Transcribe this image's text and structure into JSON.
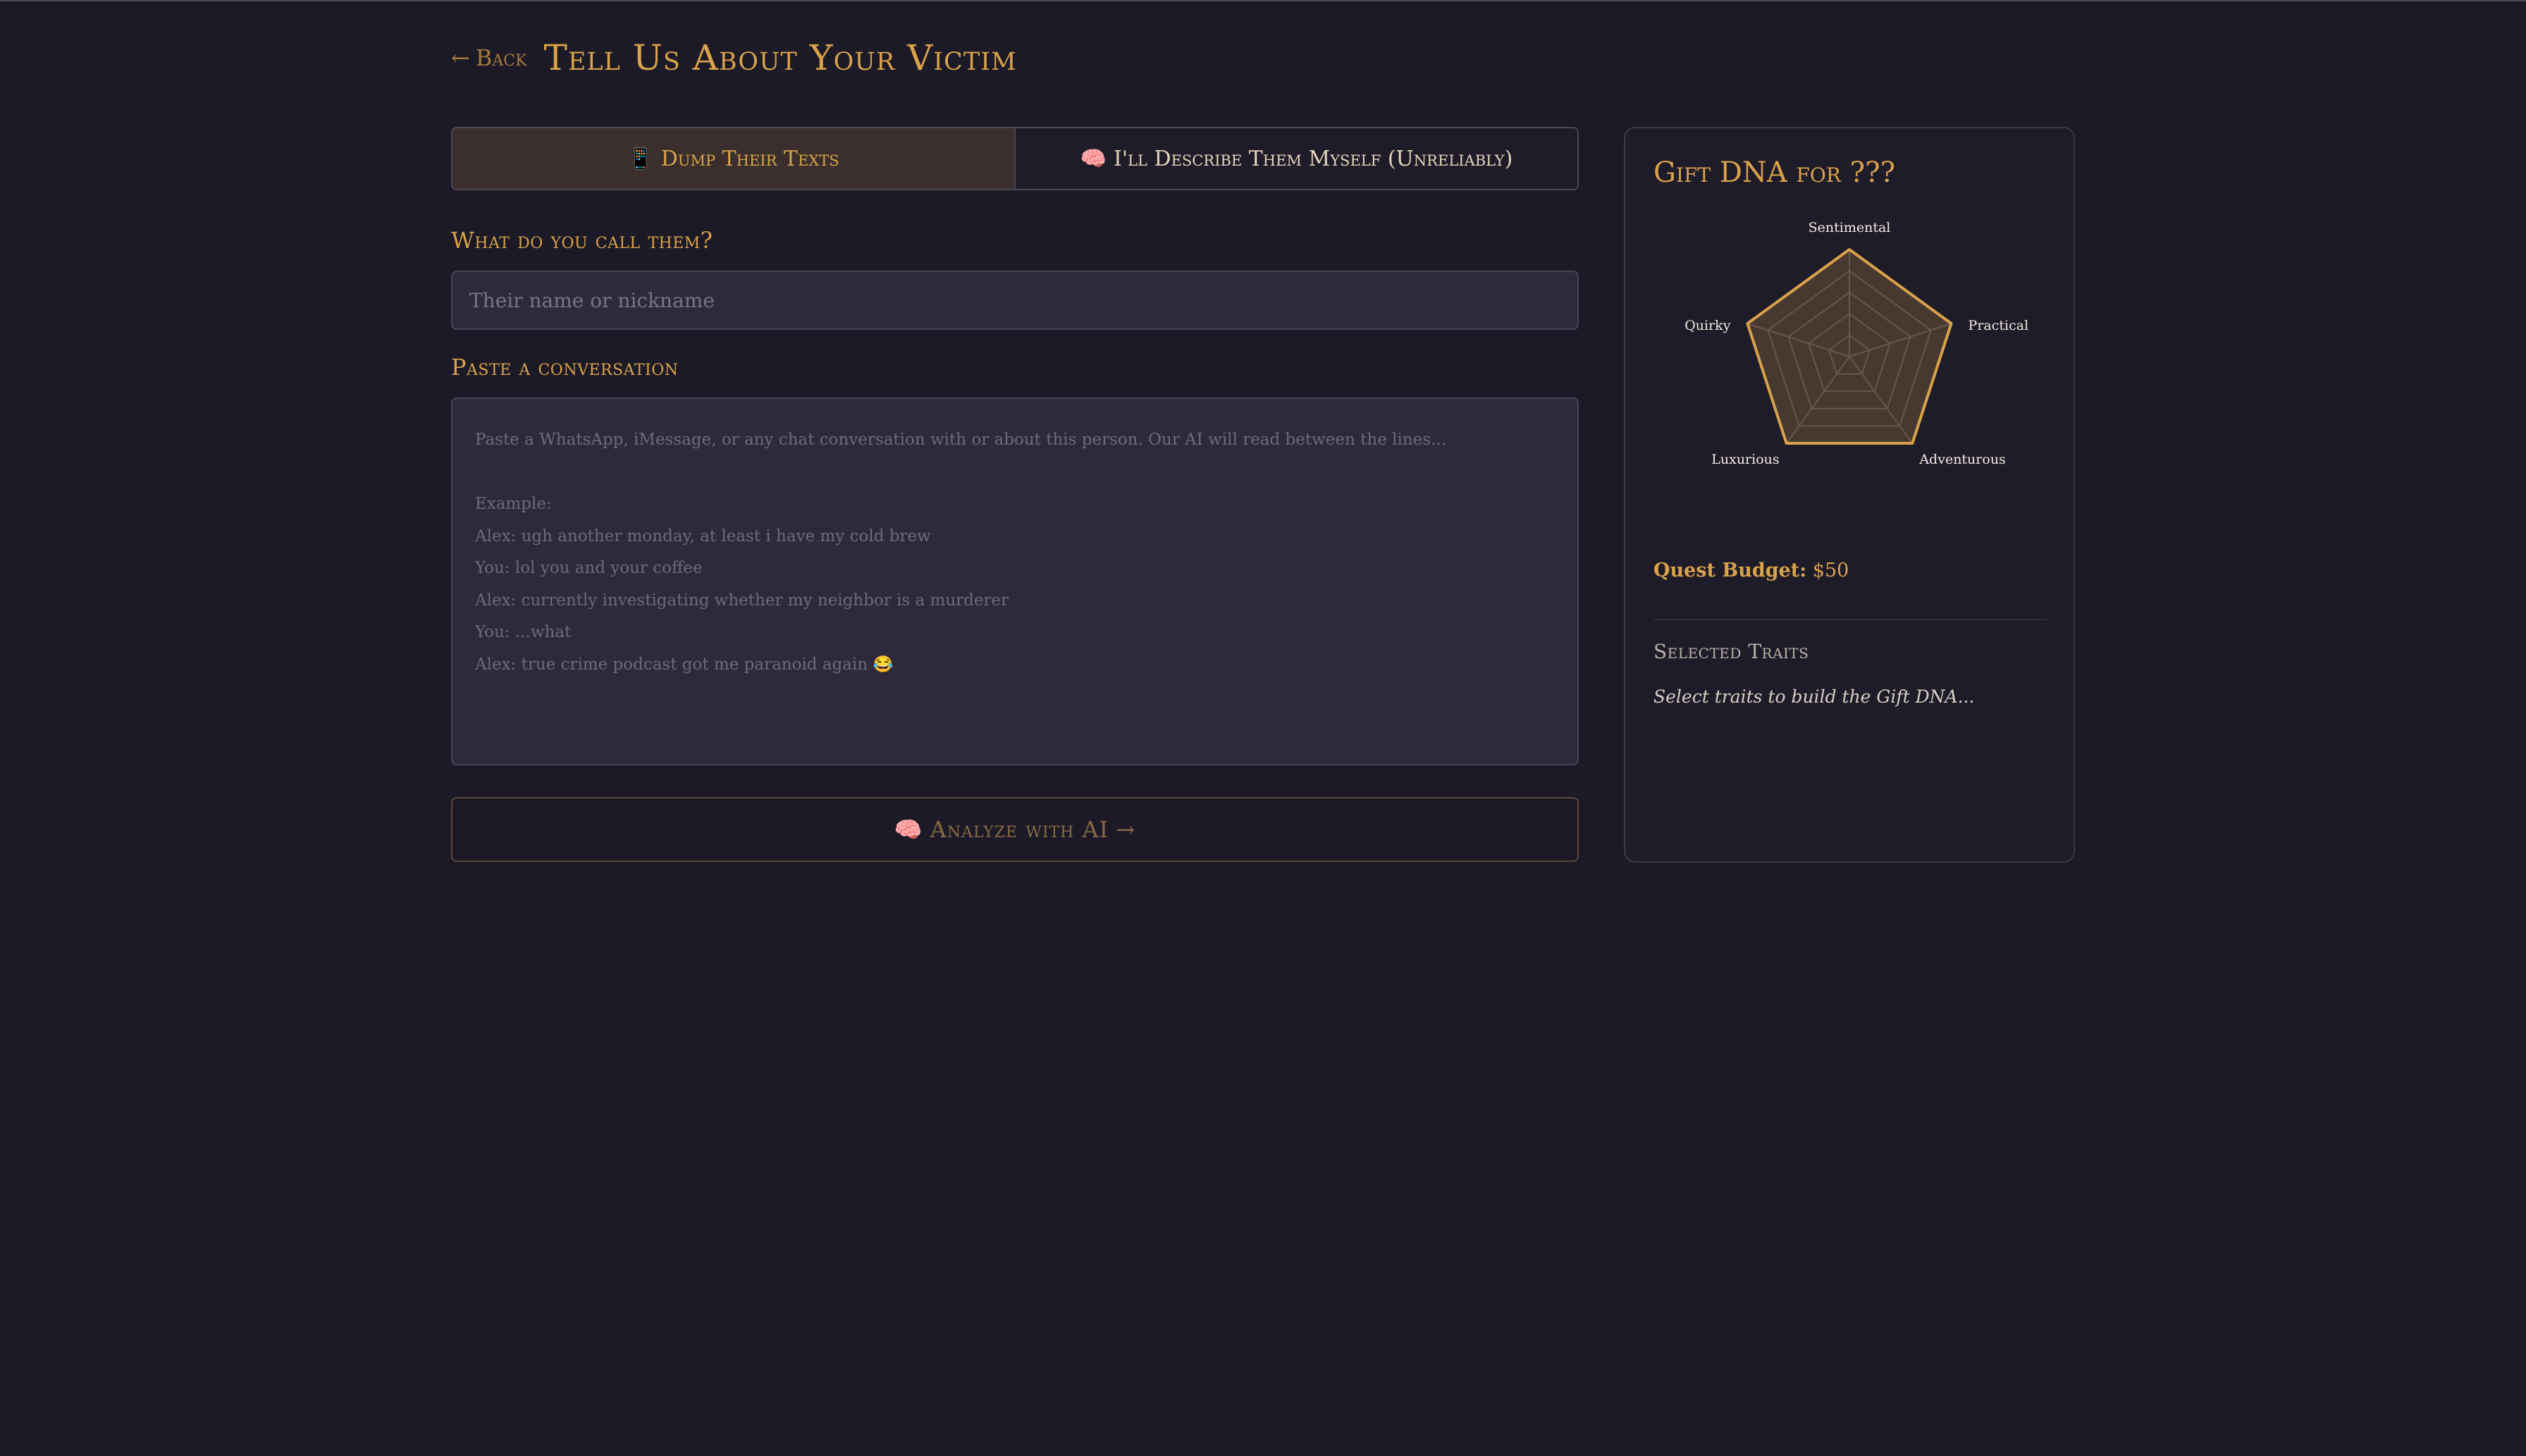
{
  "header": {
    "back_arrow": "←",
    "back_label": "Back",
    "title": "Tell Us About Your Victim"
  },
  "tabs": [
    {
      "icon": "📱",
      "label": "Dump Their Texts",
      "active": true
    },
    {
      "icon": "🧠",
      "label": "I'll Describe Them Myself (Unreliably)",
      "active": false
    }
  ],
  "name_field": {
    "label": "What do you call them?",
    "placeholder": "Their name or nickname",
    "value": ""
  },
  "conversation_field": {
    "label": "Paste a conversation",
    "placeholder_lines": [
      "Paste a WhatsApp, iMessage, or any chat conversation with or about this person. Our AI will read between the lines...",
      "",
      "Example:",
      "Alex: ugh another monday, at least i have my cold brew",
      "You: lol you and your coffee",
      "Alex: currently investigating whether my neighbor is a murderer",
      "You: ...what",
      "Alex: true crime podcast got me paranoid again 😂"
    ]
  },
  "analyze_button": {
    "icon": "🧠",
    "label": "Analyze with AI",
    "arrow": "→"
  },
  "panel": {
    "title": "Gift DNA for ???",
    "radar": {
      "axes": [
        "Sentimental",
        "Practical",
        "Adventurous",
        "Luxurious",
        "Quirky"
      ],
      "values": [
        1,
        1,
        1,
        1,
        1
      ],
      "max": 1,
      "rings": 5,
      "color": "#d9a24b"
    },
    "budget_label": "Quest Budget:",
    "budget_value": "$50",
    "traits_heading": "Selected Traits",
    "traits_empty": "Select traits to build the Gift DNA..."
  }
}
